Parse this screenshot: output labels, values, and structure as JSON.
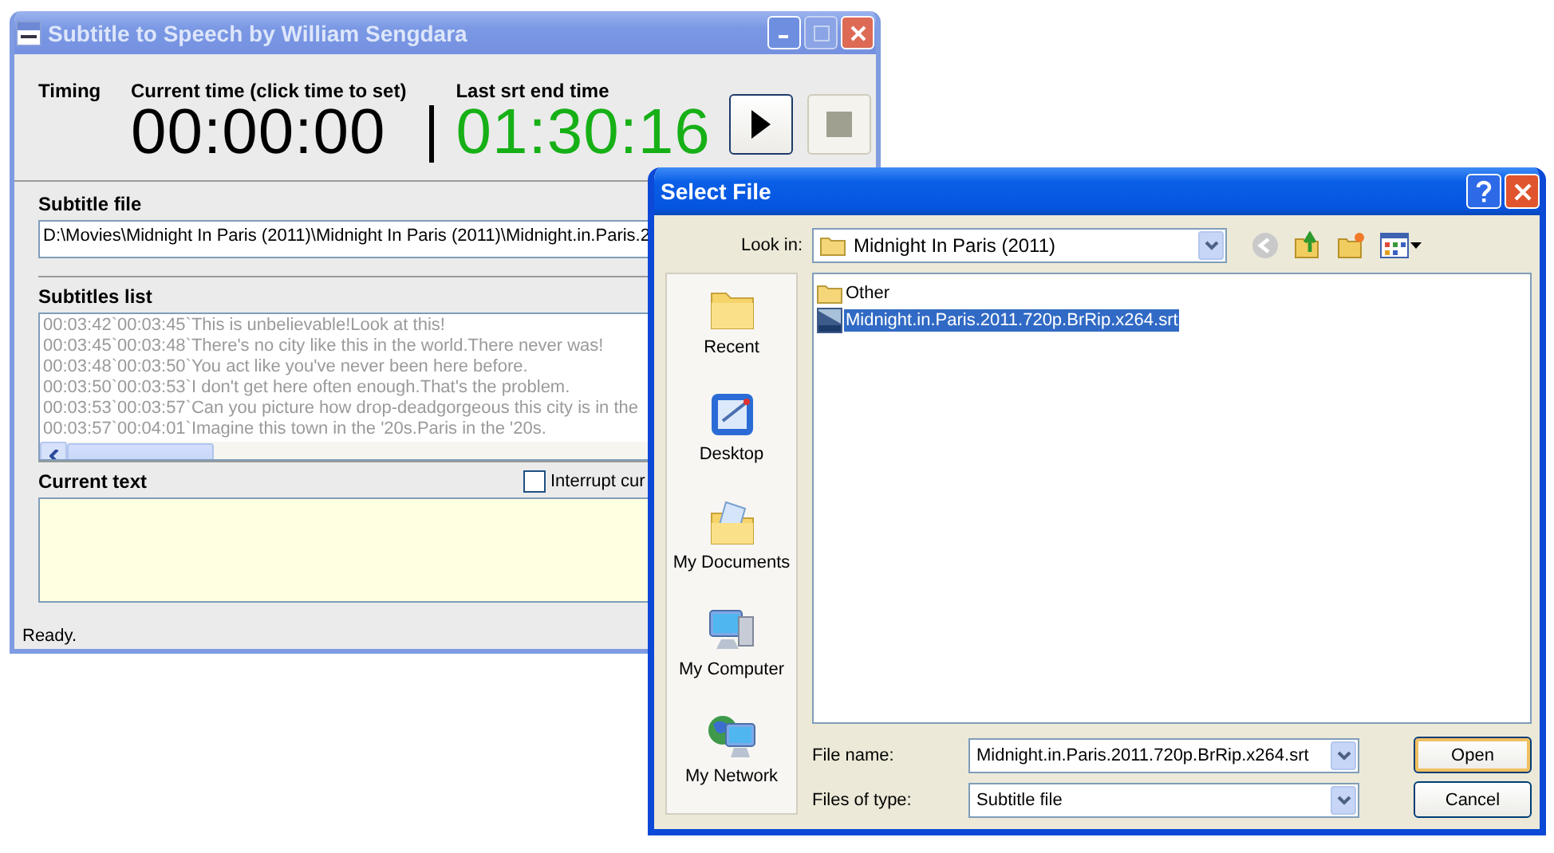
{
  "main_window": {
    "title": "Subtitle to Speech by William Sengdara",
    "timing": {
      "label": "Timing",
      "current_label": "Current time (click time to set)",
      "current_time": "00:00:00",
      "end_label": "Last srt end time",
      "end_time": "01:30:16"
    },
    "controls": [
      {
        "kind": "play",
        "disabled": false
      },
      {
        "kind": "stop",
        "disabled": true
      }
    ],
    "subtitle_file": {
      "label": "Subtitle file",
      "value": "D:\\Movies\\Midnight In Paris (2011)\\Midnight In Paris (2011)\\Midnight.in.Paris.2"
    },
    "subtitles_list": {
      "label": "Subtitles list",
      "lines": [
        "00:03:42`00:03:45`This is unbelievable!Look at this!",
        "00:03:45`00:03:48`There's no city like this in the world.There never was!",
        "00:03:48`00:03:50`You act like you've never been here before.",
        "00:03:50`00:03:53`I don't get here often enough.That's the problem.",
        "00:03:53`00:03:57`Can you picture how drop-deadgorgeous this city is in the",
        "00:03:57`00:04:01`Imagine this town in the '20s.Paris in the '20s."
      ]
    },
    "current_text": {
      "label": "Current text",
      "interrupt": {
        "label": "Interrupt cur",
        "checked": false
      }
    },
    "status": "Ready."
  },
  "dialog": {
    "title": "Select File",
    "look_in_label": "Look in:",
    "look_in": "Midnight In Paris (2011)",
    "places": [
      {
        "kind": "recent",
        "label": "Recent"
      },
      {
        "kind": "desktop",
        "label": "Desktop"
      },
      {
        "kind": "documents",
        "label": "My Documents"
      },
      {
        "kind": "computer",
        "label": "My Computer"
      },
      {
        "kind": "network",
        "label": "My Network"
      }
    ],
    "files": [
      {
        "kind": "folder",
        "name": "Other",
        "selected": false
      },
      {
        "kind": "subtitle",
        "name": "Midnight.in.Paris.2011.720p.BrRip.x264.srt",
        "selected": true
      }
    ],
    "file_name_label": "File name:",
    "file_name": "Midnight.in.Paris.2011.720p.BrRip.x264.srt",
    "file_type_label": "Files of type:",
    "file_type": "Subtitle file",
    "buttons": [
      {
        "label": "Open",
        "default": true
      },
      {
        "label": "Cancel",
        "default": false
      }
    ]
  }
}
